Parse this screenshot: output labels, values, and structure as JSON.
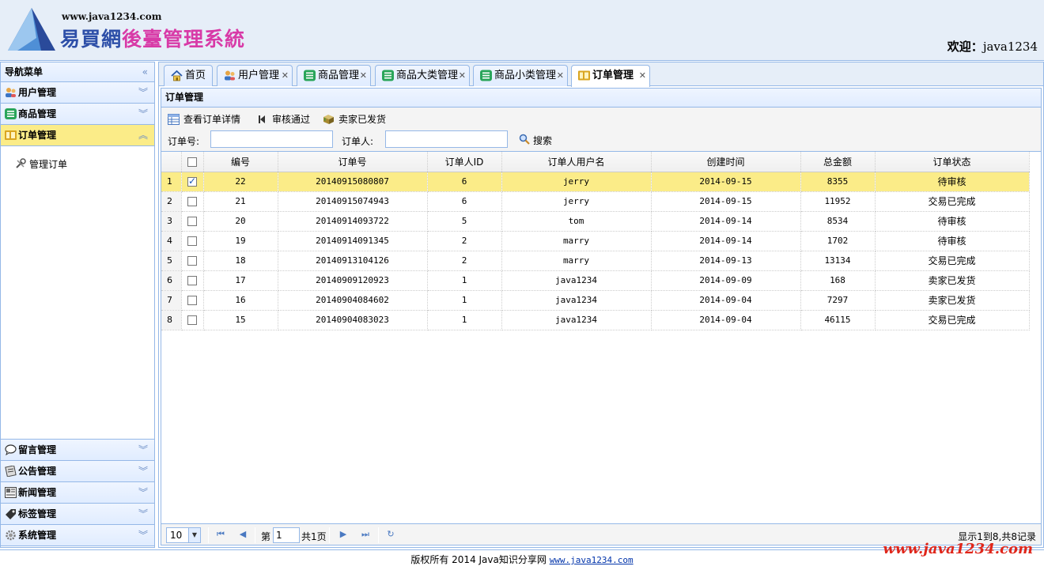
{
  "header": {
    "logo_url_text": "www.java1234.com",
    "logo_title_part1": "易買網",
    "logo_title_part2": "後臺管理系統",
    "welcome_label": "欢迎：",
    "welcome_user": "java1234"
  },
  "sidebar": {
    "title": "导航菜单",
    "top_items": [
      {
        "label": "用户管理",
        "icon": "users-icon"
      },
      {
        "label": "商品管理",
        "icon": "list-icon"
      },
      {
        "label": "订单管理",
        "icon": "order-icon",
        "active": true
      }
    ],
    "sub_item": {
      "label": "管理订单",
      "icon": "tools-icon"
    },
    "bottom_items": [
      {
        "label": "留言管理",
        "icon": "message-icon"
      },
      {
        "label": "公告管理",
        "icon": "notice-icon"
      },
      {
        "label": "新闻管理",
        "icon": "news-icon"
      },
      {
        "label": "标签管理",
        "icon": "tag-icon"
      },
      {
        "label": "系统管理",
        "icon": "gear-icon"
      }
    ]
  },
  "tabs": [
    {
      "label": "首页",
      "closable": false
    },
    {
      "label": "用户管理",
      "closable": true
    },
    {
      "label": "商品管理",
      "closable": true
    },
    {
      "label": "商品大类管理",
      "closable": true
    },
    {
      "label": "商品小类管理",
      "closable": true
    },
    {
      "label": "订单管理",
      "closable": true,
      "active": true
    }
  ],
  "panel": {
    "title": "订单管理"
  },
  "toolbar": {
    "view_detail_label": "查看订单详情",
    "approve_label": "审核通过",
    "shipped_label": "卖家已发货",
    "order_no_label": "订单号:",
    "order_no_value": "",
    "orderer_label": "订单人:",
    "orderer_value": "",
    "search_label": "搜索"
  },
  "grid": {
    "columns": [
      "编号",
      "订单号",
      "订单人ID",
      "订单人用户名",
      "创建时间",
      "总金额",
      "订单状态"
    ],
    "rows": [
      {
        "rn": "1",
        "checked": true,
        "selected": true,
        "id": "22",
        "order_no": "20140915080807",
        "user_id": "6",
        "username": "jerry",
        "created": "2014-09-15",
        "total": "8355",
        "status": "待审核"
      },
      {
        "rn": "2",
        "checked": false,
        "id": "21",
        "order_no": "20140915074943",
        "user_id": "6",
        "username": "jerry",
        "created": "2014-09-15",
        "total": "11952",
        "status": "交易已完成"
      },
      {
        "rn": "3",
        "checked": false,
        "id": "20",
        "order_no": "20140914093722",
        "user_id": "5",
        "username": "tom",
        "created": "2014-09-14",
        "total": "8534",
        "status": "待审核"
      },
      {
        "rn": "4",
        "checked": false,
        "id": "19",
        "order_no": "20140914091345",
        "user_id": "2",
        "username": "marry",
        "created": "2014-09-14",
        "total": "1702",
        "status": "待审核"
      },
      {
        "rn": "5",
        "checked": false,
        "id": "18",
        "order_no": "20140913104126",
        "user_id": "2",
        "username": "marry",
        "created": "2014-09-13",
        "total": "13134",
        "status": "交易已完成"
      },
      {
        "rn": "6",
        "checked": false,
        "id": "17",
        "order_no": "20140909120923",
        "user_id": "1",
        "username": "java1234",
        "created": "2014-09-09",
        "total": "168",
        "status": "卖家已发货"
      },
      {
        "rn": "7",
        "checked": false,
        "id": "16",
        "order_no": "20140904084602",
        "user_id": "1",
        "username": "java1234",
        "created": "2014-09-04",
        "total": "7297",
        "status": "卖家已发货"
      },
      {
        "rn": "8",
        "checked": false,
        "id": "15",
        "order_no": "20140904083023",
        "user_id": "1",
        "username": "java1234",
        "created": "2014-09-04",
        "total": "46115",
        "status": "交易已完成"
      }
    ]
  },
  "pager": {
    "page_size": "10",
    "page_prefix": "第",
    "page_value": "1",
    "page_suffix": "共1页",
    "info": "显示1到8,共8记录"
  },
  "footer": {
    "text": "版权所有 2014 Java知识分享网 ",
    "link": "www.java1234.com",
    "watermark": "www.java1234.com"
  },
  "colors": {
    "border": "#95b8e7",
    "header_bg": "#e6eef8",
    "selected_row": "#fbec88",
    "watermark": "#e0261a"
  }
}
